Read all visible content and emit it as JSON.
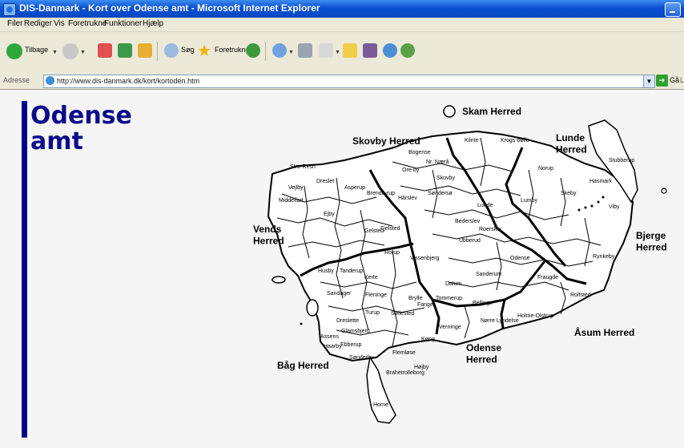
{
  "window": {
    "title": "DIS-Danmark - Kort over Odense amt - Microsoft Internet Explorer"
  },
  "menu": {
    "items": [
      "Filer",
      "Rediger",
      "Vis",
      "Foretrukne",
      "Funktioner",
      "Hjælp"
    ]
  },
  "toolbar": {
    "back_label": "Tilbage",
    "search_label": "Søg",
    "favorites_label": "Foretrukne"
  },
  "address": {
    "label": "Adresse",
    "url": "http://www.dis-danmark.dk/kort/kortoden.htm",
    "go_label": "Gå",
    "links_label": "L"
  },
  "page": {
    "title": "Odense amt"
  },
  "map": {
    "herreder": [
      "Skam Herred",
      "Skovby Herred",
      "Lunde Herred",
      "Vends Herred",
      "Bjerge Herred",
      "Båg Herred",
      "Odense Herred",
      "Åsum Herred"
    ],
    "parishes": [
      "Klinte",
      "Krogs-bølle",
      "Bogense",
      "Norup",
      "Ore-by",
      "Nr. Nærå",
      "Stubberup",
      "Skeby",
      "Viby",
      "Hasmark",
      "Strø-Resn",
      "Vejlby",
      "Dreslet",
      "Asperup",
      "Skovby",
      "Hårslev",
      "Søndersø",
      "Lumby",
      "Middelfart",
      "Lunde",
      "Bederslev",
      "Brende-rup",
      "Fjelsted",
      "Roerslev",
      "Ejby",
      "Rynkeby",
      "Gelsted",
      "Ubberud",
      "Odense",
      "Rorup",
      "Vissenbjerg",
      "Fraugde",
      "Husby",
      "Kerte",
      "Tanderup",
      "Sandager",
      "Sanderum",
      "Dalum",
      "Tommerup",
      "Verninge",
      "Assens",
      "Fleninge",
      "Bellinge",
      "Brylle",
      "Dreslette",
      "Ebberup",
      "Turup",
      "Søllested",
      "Køng",
      "Glamsbjerg",
      "Højby",
      "Fangel",
      "Nørre Lyndelse",
      "Holme-Olstrup",
      "Rolfsted",
      "Flemløse",
      "Haarby",
      "Sønderby",
      "Brahetrolleborg",
      "Horne"
    ]
  },
  "colors": {
    "titlebar": "#0548c4",
    "page_title": "#0b0b8a",
    "sidebar_bar": "#00008b",
    "content_bg": "#f5f5f5"
  }
}
